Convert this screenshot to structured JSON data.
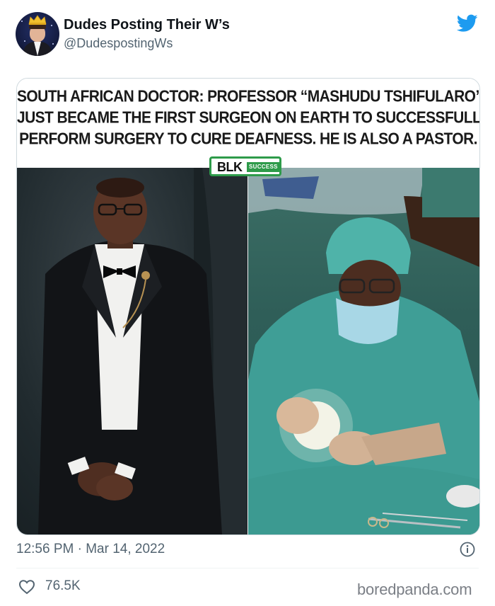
{
  "tweet": {
    "author": {
      "display_name": "Dudes Posting Their W’s",
      "handle": "@DudespostingWs",
      "avatar_icon": "avatar-crowned-man"
    },
    "platform_icon": "twitter-bird-icon",
    "brand_color": "#1d9bf0",
    "media": {
      "headline_lines": [
        "SOUTH AFRICAN DOCTOR: PROFESSOR “MASHUDU TSHIFULARO”",
        "JUST BECAME THE FIRST SURGEON ON EARTH TO SUCCESSFULLY",
        "PERFORM SURGERY TO CURE DEAFNESS. HE IS ALSO A PASTOR."
      ],
      "badge": {
        "primary": "BLK",
        "secondary": "SUCCESS",
        "color": "#2e9b4a"
      },
      "photos": [
        {
          "subject": "man-in-tuxedo-portrait"
        },
        {
          "subject": "surgeon-in-scrubs-operating"
        }
      ]
    },
    "timestamp": "12:56 PM · Mar 14, 2022",
    "info_icon": "info-icon",
    "likes": {
      "icon": "heart-icon",
      "count": "76.5K"
    }
  },
  "watermark": "boredpanda.com"
}
